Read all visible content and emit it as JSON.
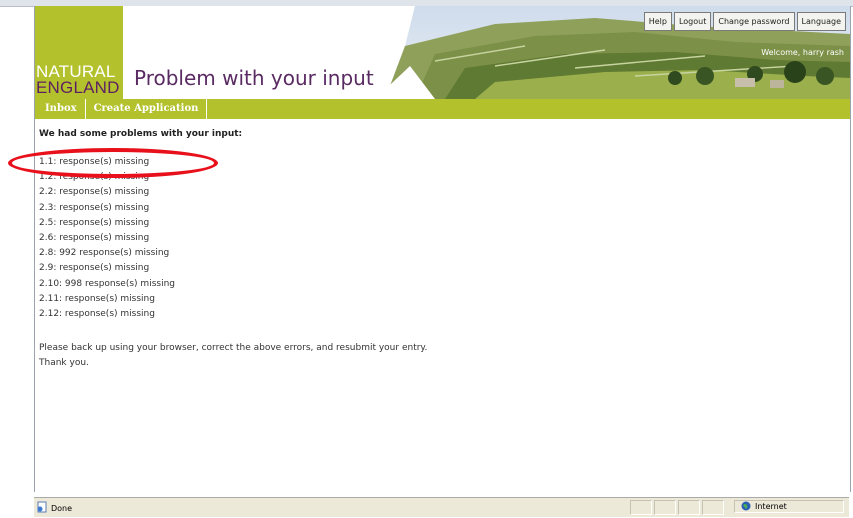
{
  "header": {
    "logo_line1": "NATURAL",
    "logo_line2": "ENGLAND",
    "page_title": "Problem with your input",
    "welcome": "Welcome, harry rash"
  },
  "topnav": [
    "Help",
    "Logout",
    "Change password",
    "Language"
  ],
  "nav": [
    "Inbox",
    "Create Application"
  ],
  "content": {
    "heading": "We had some problems with your input:",
    "errors": [
      "1.1: response(s) missing",
      "1.2: response(s) missing",
      "2.2: response(s) missing",
      "2.3: response(s) missing",
      "2.5: response(s) missing",
      "2.6: response(s) missing",
      "2.8: 992 response(s) missing",
      "2.9: response(s) missing",
      "2.10: 998 response(s) missing",
      "2.11: response(s) missing",
      "2.12: response(s) missing"
    ],
    "message_line1": "Please back up using your browser, correct the above errors, and resubmit your entry.",
    "message_line2": "Thank you."
  },
  "statusbar": {
    "status_text": "Done",
    "zone_text": "Internet"
  },
  "colors": {
    "brand_green": "#b3c22c",
    "brand_purple": "#5a2a63",
    "highlight_red": "#e8101a"
  },
  "icons": [
    "page-done-icon",
    "internet-globe-icon"
  ]
}
